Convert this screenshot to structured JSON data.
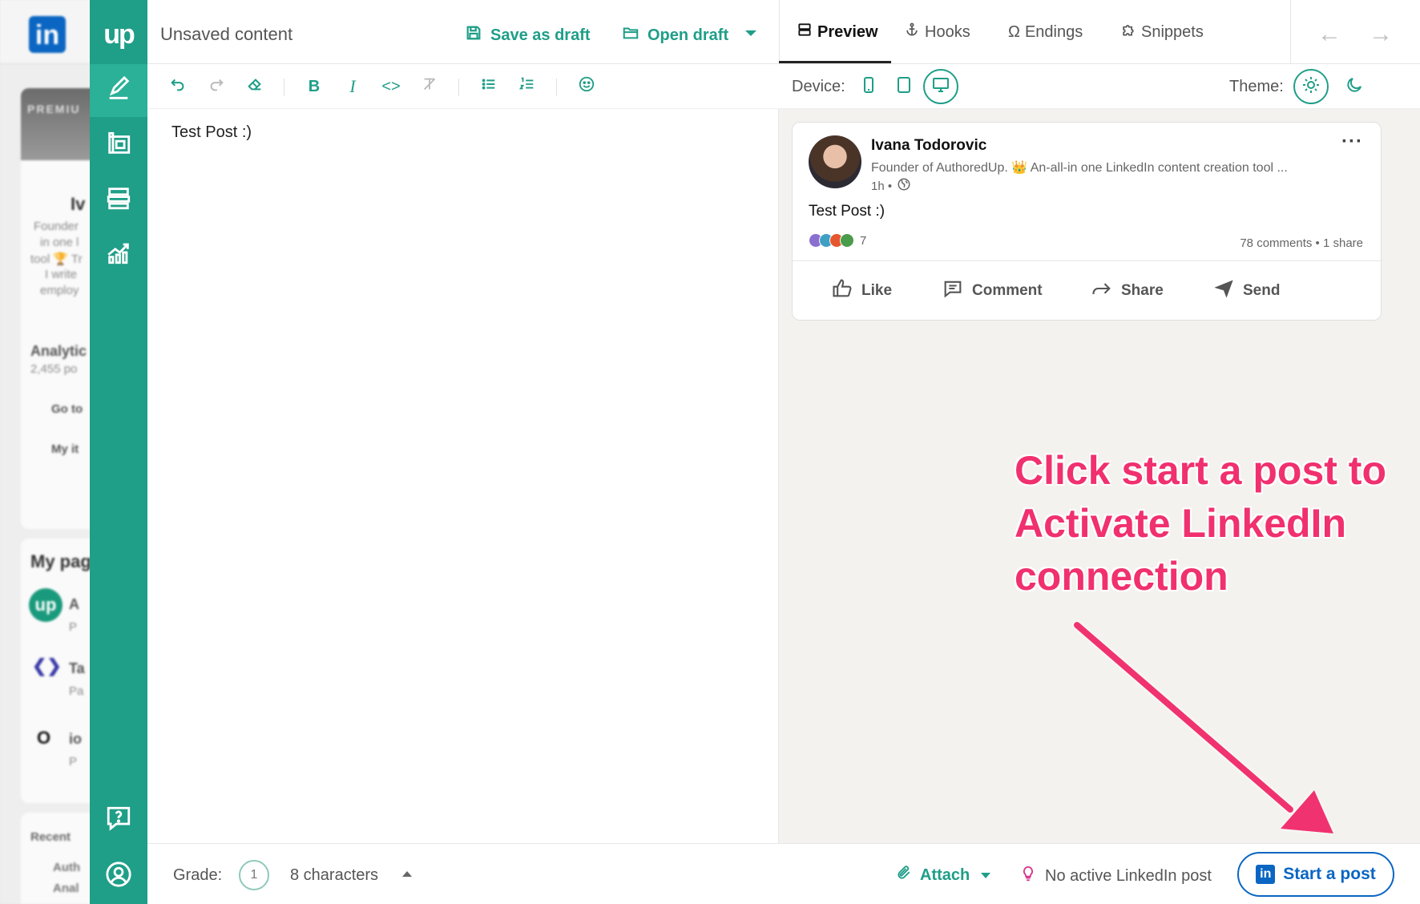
{
  "background": {
    "li_logo": "in",
    "premium": "PREMIU",
    "name_fragment": "Iv",
    "desc_lines": [
      "Founder",
      "in one l",
      "tool 🏆 Tr",
      "I write",
      "employ"
    ],
    "analytics_title": "Analytic",
    "analytics_sub": "2,455 po",
    "goto": "Go to",
    "myitems": "My it",
    "mypages": "My pag",
    "page1": "A",
    "page1_sub": "P",
    "page2": "Ta",
    "page2_sub": "Pa",
    "page3": "io",
    "page3_sub": "P",
    "recent": "Recent",
    "recent1": "Auth",
    "recent2": "Anal"
  },
  "sidebar": {
    "logo": "up",
    "items": [
      {
        "icon": "pen-icon"
      },
      {
        "icon": "template-icon"
      },
      {
        "icon": "archive-icon"
      },
      {
        "icon": "analytics-icon"
      },
      {
        "icon": "help-icon"
      },
      {
        "icon": "profile-icon"
      }
    ]
  },
  "header": {
    "title": "Unsaved content",
    "save_label": "Save as draft",
    "open_label": "Open draft",
    "tabs": [
      {
        "label": "Preview",
        "active": true
      },
      {
        "label": "Hooks"
      },
      {
        "label": "Endings"
      },
      {
        "label": "Snippets"
      }
    ]
  },
  "editor": {
    "content": "Test Post :)"
  },
  "preview_bar": {
    "device_label": "Device:",
    "theme_label": "Theme:",
    "active_device": "desktop",
    "active_theme": "light"
  },
  "post": {
    "author": "Ivana Todorovic",
    "headline": "Founder of AuthoredUp. 👑 An-all-in one LinkedIn content creation tool ...",
    "time": "1h •",
    "text": "Test Post :)",
    "reaction_count": "7",
    "stats": "78 comments • 1 share",
    "actions": [
      "Like",
      "Comment",
      "Share",
      "Send"
    ]
  },
  "annotation": {
    "text": "Click start a post to Activate LinkedIn connection",
    "color": "#f0306f"
  },
  "bottom": {
    "grade_label": "Grade:",
    "grade_value": "1",
    "chars": "8 characters",
    "attach": "Attach",
    "no_active": "No active LinkedIn post",
    "start": "Start a post"
  },
  "colors": {
    "brand": "#1f9e88",
    "linkedin": "#0a66c2"
  }
}
